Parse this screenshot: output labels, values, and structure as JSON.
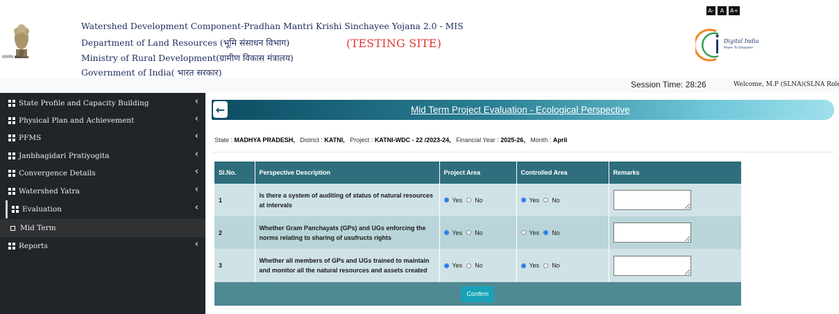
{
  "header": {
    "line1": "Watershed Development Component-Pradhan Mantri Krishi Sinchayee Yojana 2.0 - MIS",
    "line2": "Department of Land Resources (भूमि संसाधन विभाग)",
    "line3": "Ministry of Rural Development(ग्रामीण विकास मंत्रालय)",
    "line4": "Government of India( भारत सरकार)",
    "testing_label": "(TESTING SITE)",
    "emblem_caption": "सत्यमेव जयते",
    "font_controls": [
      "A-",
      "A",
      "A+"
    ],
    "digital_india": "Digital India",
    "digital_india_tagline": "Power To Empower",
    "session_time": "Session Time: 28:26",
    "welcome": "Welcome, M.P (SLNA)(SLNA Role) ▾"
  },
  "sidebar": {
    "items": [
      {
        "label": "State Profile and Capacity Building"
      },
      {
        "label": "Physical Plan and Achievement"
      },
      {
        "label": "PFMS"
      },
      {
        "label": "Janbhagidari Pratiyogita"
      },
      {
        "label": "Convergence Details"
      },
      {
        "label": "Watershed Yatra"
      },
      {
        "label": "Evaluation"
      },
      {
        "label": "Mid Term"
      },
      {
        "label": "Reports"
      }
    ]
  },
  "page": {
    "title": "Mid Term Project Evaluation - Ecological Perspective",
    "meta": {
      "state_label": "State :",
      "state": "MADHYA PRADESH,",
      "district_label": "District :",
      "district": "KATNI,",
      "project_label": "Project :",
      "project": "KATNI-WDC - 22 /2023-24,",
      "fy_label": "Financial Year :",
      "fy": "2025-26,",
      "month_label": "Month :",
      "month": "April"
    },
    "table": {
      "headers": [
        "Sl.No.",
        "Perspective Description",
        "Project Area",
        "Controlled Area",
        "Remarks"
      ],
      "rows": [
        {
          "sl": "1",
          "desc": "Is there a system of auditing of status of natural resources at intervals",
          "project": "Yes",
          "controlled": "Yes",
          "remark": ""
        },
        {
          "sl": "2",
          "desc": "Whether Gram Panchayats (GPs) and UGs enforcing the norms relating to sharing of usufructs rights",
          "project": "Yes",
          "controlled": "No",
          "remark": ""
        },
        {
          "sl": "3",
          "desc": "Whether all members of GPs and UGs trained to maintain and monitor all the natural resources and assets created",
          "project": "Yes",
          "controlled": "Yes",
          "remark": ""
        }
      ],
      "yes_label": "Yes",
      "no_label": "No"
    },
    "confirm_label": "Confirm"
  }
}
